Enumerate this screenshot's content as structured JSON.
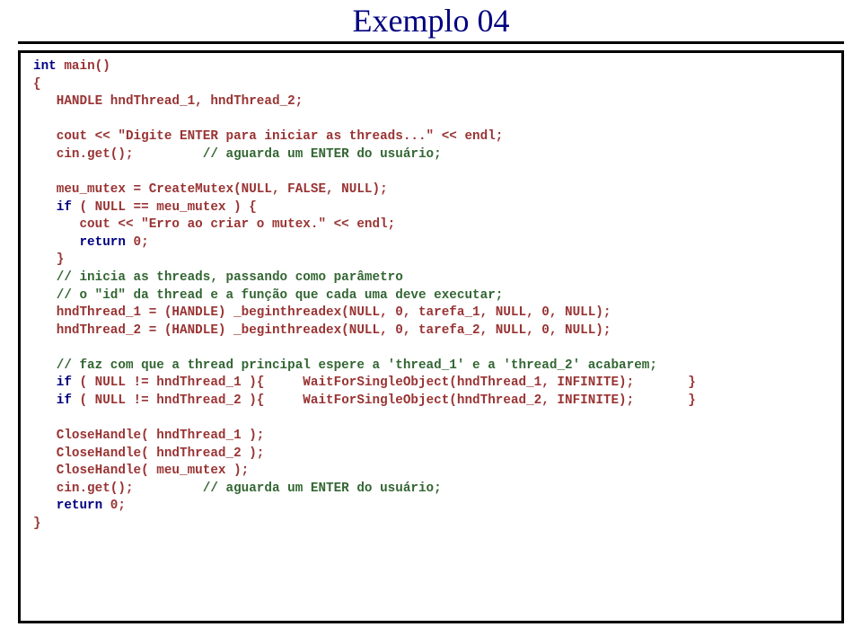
{
  "title": "Exemplo 04",
  "code": {
    "l1_kw": "int",
    "l1_rest": " main()",
    "l2": "{",
    "l3": "   HANDLE hndThread_1, hndThread_2;",
    "l4": "",
    "l5": "   cout << \"Digite ENTER para iniciar as threads...\" << endl;",
    "l6a": "   cin.get();         ",
    "l6c": "// aguarda um ENTER do usuário;",
    "l7": "",
    "l8": "   meu_mutex = CreateMutex(NULL, FALSE, NULL);",
    "l9a_kw": "   if",
    "l9b": " ( NULL == meu_mutex ) {",
    "l10": "      cout << \"Erro ao criar o mutex.\" << endl;",
    "l11a_kw": "      return",
    "l11b": " 0;",
    "l12": "   }",
    "l13c": "   // inicia as threads, passando como parâmetro",
    "l14c": "   // o \"id\" da thread e a função que cada uma deve executar;",
    "l15": "   hndThread_1 = (HANDLE) _beginthreadex(NULL, 0, tarefa_1, NULL, 0, NULL);",
    "l16": "   hndThread_2 = (HANDLE) _beginthreadex(NULL, 0, tarefa_2, NULL, 0, NULL);",
    "l17": "",
    "l18c": "   // faz com que a thread principal espere a 'thread_1' e a 'thread_2' acabarem;",
    "l19a_kw": "   if",
    "l19b": " ( NULL != hndThread_1 ){     WaitForSingleObject(hndThread_1, INFINITE);       }",
    "l20a_kw": "   if",
    "l20b": " ( NULL != hndThread_2 ){     WaitForSingleObject(hndThread_2, INFINITE);       }",
    "l21": "",
    "l22": "   CloseHandle( hndThread_1 );",
    "l23": "   CloseHandle( hndThread_2 );",
    "l24": "   CloseHandle( meu_mutex );",
    "l25a": "   cin.get();         ",
    "l25c": "// aguarda um ENTER do usuário;",
    "l26a_kw": "   return",
    "l26b": " 0;",
    "l27": "}"
  }
}
